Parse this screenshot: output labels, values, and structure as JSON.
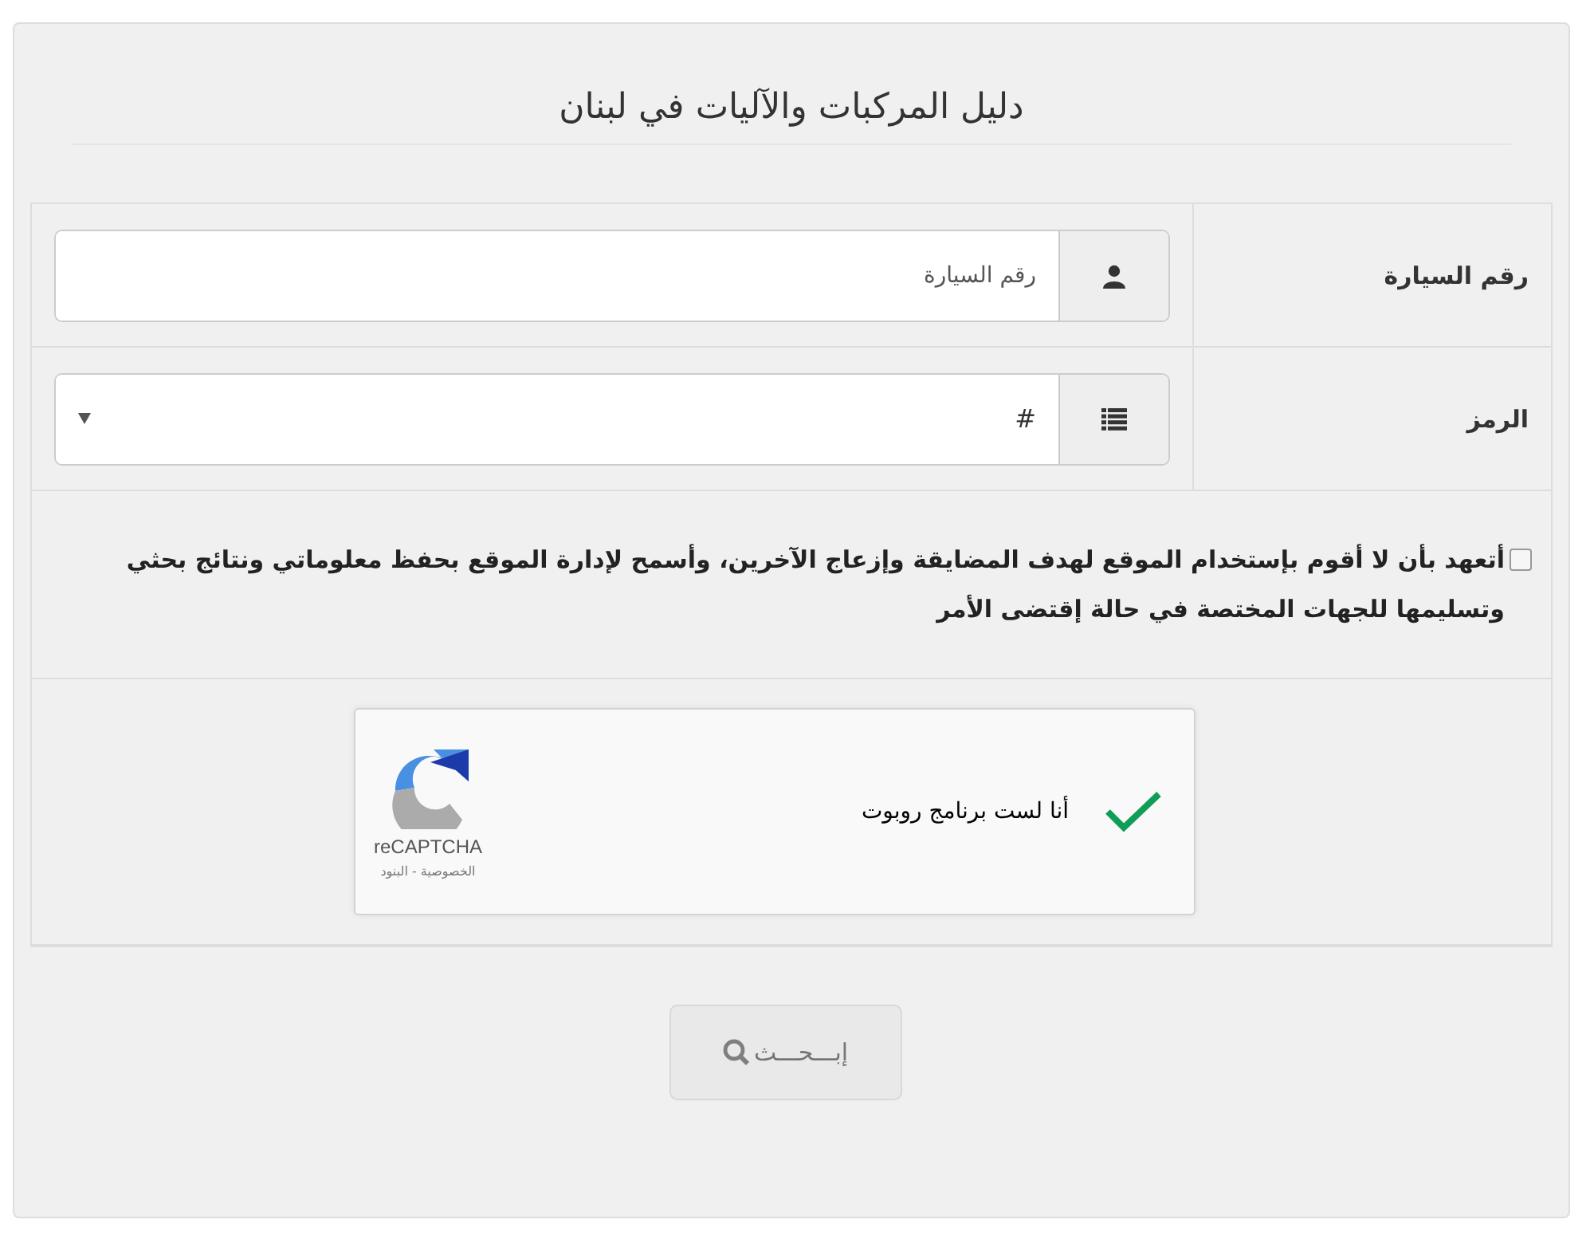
{
  "title": "دليل المركبات والآليات في لبنان",
  "fields": [
    {
      "kind": "text",
      "label": "رقم السيارة",
      "placeholder": "رقم السيارة"
    },
    {
      "kind": "select",
      "label": "الرمز",
      "value": "#"
    }
  ],
  "agreement": {
    "checked": false,
    "text": "أتعهد بأن لا أقوم بإستخدام الموقع لهدف المضايقة وإزعاج الآخرين، وأسمح لإدارة الموقع بحفظ معلوماتي ونتائج بحثي وتسليمها للجهات المختصة في حالة إقتضى الأمر"
  },
  "captcha": {
    "verified": true,
    "label": "أنا لست برنامج روبوت",
    "brand": "reCAPTCHA",
    "links": "الخصوصية - البنود"
  },
  "search_button": {
    "label": "إبـــحـــث",
    "disabled": true
  }
}
